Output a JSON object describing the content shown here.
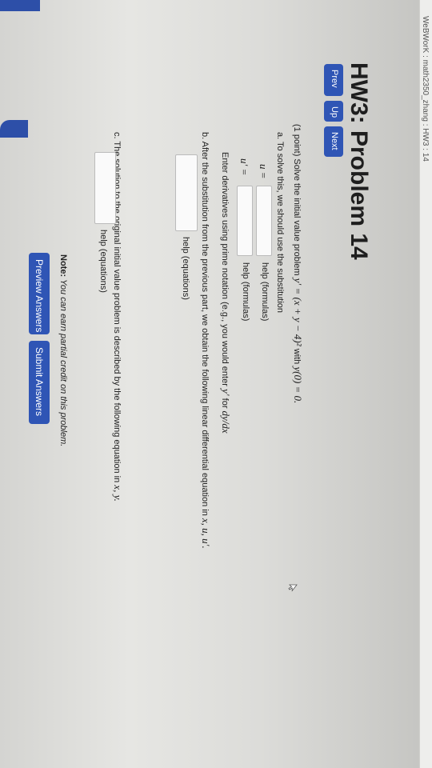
{
  "header": {
    "course": "WeBWorK : math2350_zhang : HW3 : 14"
  },
  "title": "HW3: Problem 14",
  "nav": {
    "prev": "Prev",
    "up": "Up",
    "next": "Next"
  },
  "problem": {
    "intro_points": "(1 point)",
    "intro_text": "Solve the initial value problem",
    "ode": "y′ = (x + y − 4)²",
    "with": "with",
    "initial_condition": "y(0) = 0.",
    "part_a": "a. To solve this, we should use the substitution",
    "u_label": "u =",
    "uprime_label": "u′ =",
    "help_formulas": "help (formulas)",
    "derivative_hint": "Enter derivatives using prime notation (e.g., you would enter",
    "derivative_hint_y": "y′",
    "derivative_hint_for": "for",
    "derivative_hint_frac": "dy/dx",
    "part_b": "b. After the substitution from the previous part, we obtain the following linear differential equation in",
    "part_b_vars": "x, u, u′.",
    "help_equations": "help (equations)",
    "part_c": "c. The solution to the original initial value problem is described by the following equation in",
    "part_c_vars": "x, y."
  },
  "note": {
    "label": "Note:",
    "text": "You can earn partial credit on this problem."
  },
  "buttons": {
    "preview": "Preview Answers",
    "submit": "Submit Answers"
  },
  "colors": {
    "button": "#2f55b5",
    "sidebar": "#2d4fa8"
  }
}
